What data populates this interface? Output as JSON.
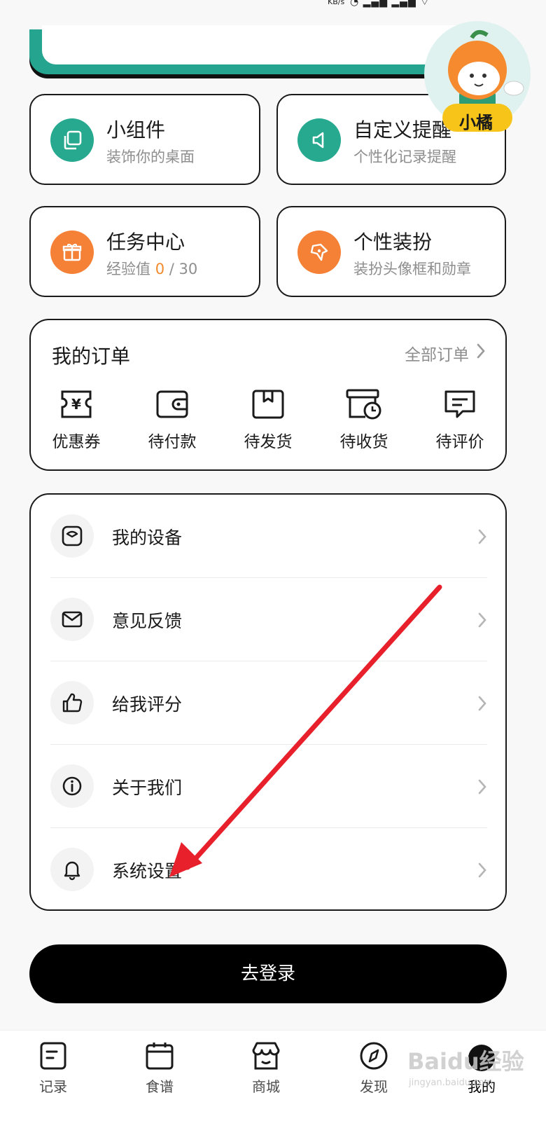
{
  "status_bar": {
    "net_speed": "KB/s"
  },
  "features": [
    {
      "title": "小组件",
      "subtitle": "装饰你的桌面",
      "icon": "copy-icon",
      "color": "#26a98f"
    },
    {
      "title": "自定义提醒",
      "subtitle": "个性化记录提醒",
      "icon": "speaker-icon",
      "color": "#26a98f"
    },
    {
      "title": "任务中心",
      "subtitle_prefix": "经验值 ",
      "exp_current": "0",
      "exp_total": " / 30",
      "icon": "gift-icon",
      "color": "#f58137"
    },
    {
      "title": "个性装扮",
      "subtitle": "装扮头像框和勋章",
      "icon": "badge-icon",
      "color": "#f58137"
    }
  ],
  "mascot": {
    "name": "小橘"
  },
  "orders": {
    "title": "我的订单",
    "all_label": "全部订单",
    "items": [
      {
        "label": "优惠券",
        "icon": "coupon-icon"
      },
      {
        "label": "待付款",
        "icon": "wallet-icon"
      },
      {
        "label": "待发货",
        "icon": "package-icon"
      },
      {
        "label": "待收货",
        "icon": "delivery-clock-icon"
      },
      {
        "label": "待评价",
        "icon": "comment-icon"
      }
    ]
  },
  "menu": [
    {
      "label": "我的设备",
      "icon": "scale-icon"
    },
    {
      "label": "意见反馈",
      "icon": "mail-icon"
    },
    {
      "label": "给我评分",
      "icon": "thumbs-up-icon"
    },
    {
      "label": "关于我们",
      "icon": "info-icon"
    },
    {
      "label": "系统设置",
      "icon": "bell-icon"
    }
  ],
  "login_button": "去登录",
  "tabs": [
    {
      "label": "记录",
      "icon": "note-icon"
    },
    {
      "label": "食谱",
      "icon": "calendar-icon"
    },
    {
      "label": "商城",
      "icon": "store-icon"
    },
    {
      "label": "发现",
      "icon": "compass-icon"
    },
    {
      "label": "我的",
      "icon": "profile-icon",
      "active": true
    }
  ],
  "watermark": {
    "brand": "Baidu经验",
    "url": "jingyan.baidu.com"
  },
  "colors": {
    "teal": "#26a98f",
    "orange": "#f58137",
    "annotation_arrow": "#e8202b"
  }
}
